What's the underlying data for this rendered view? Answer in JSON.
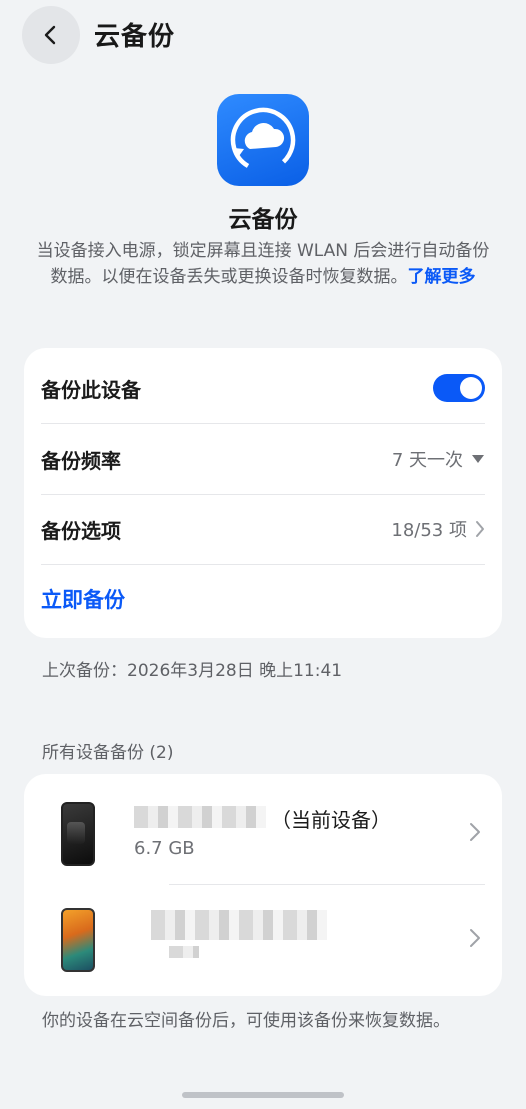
{
  "header": {
    "title": "云备份",
    "back_icon": "chevron-left-icon"
  },
  "hero": {
    "app_icon": "cloud-backup-icon",
    "app_name": "云备份",
    "description": "当设备接入电源，锁定屏幕且连接 WLAN 后会进行自动备份数据。以便在设备丢失或更换设备时恢复数据。",
    "learn_more": "了解更多"
  },
  "settings": {
    "backup_this_device": {
      "label": "备份此设备",
      "toggle_on": true
    },
    "frequency": {
      "label": "备份频率",
      "value": "7 天一次"
    },
    "options": {
      "label": "备份选项",
      "value": "18/53 项"
    },
    "backup_now": "立即备份"
  },
  "last_backup": "上次备份：2026年3月28日 晚上11:41",
  "devices_section": {
    "label": "所有设备备份 (2)",
    "devices": [
      {
        "name_suffix": "（当前设备）",
        "size": "6.7 GB",
        "icon": "phone-dark-icon"
      },
      {
        "name_suffix": "",
        "size": "",
        "icon": "phone-color-icon"
      }
    ]
  },
  "footer_note": "你的设备在云空间备份后，可使用该备份来恢复数据。",
  "colors": {
    "accent": "#0a59f7",
    "background": "#f1f3f5",
    "card": "#ffffff"
  }
}
